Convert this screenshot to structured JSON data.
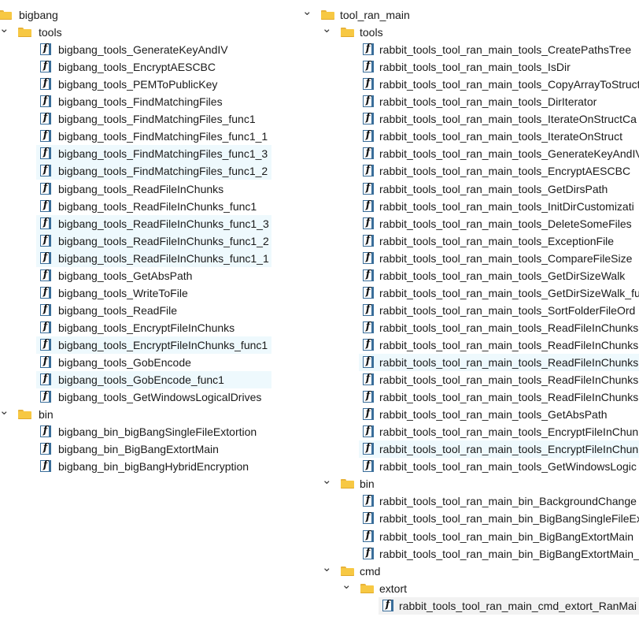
{
  "left": {
    "rows": [
      {
        "type": "folder",
        "depth": 0,
        "label": "bigbang",
        "chev": "collapse",
        "hl": false
      },
      {
        "type": "folder",
        "depth": 1,
        "label": "tools",
        "chev": "expand",
        "hl": false
      },
      {
        "type": "func",
        "depth": 2,
        "label": "bigbang_tools_GenerateKeyAndIV",
        "hl": false
      },
      {
        "type": "func",
        "depth": 2,
        "label": "bigbang_tools_EncryptAESCBC",
        "hl": false
      },
      {
        "type": "func",
        "depth": 2,
        "label": "bigbang_tools_PEMToPublicKey",
        "hl": false
      },
      {
        "type": "func",
        "depth": 2,
        "label": "bigbang_tools_FindMatchingFiles",
        "hl": false
      },
      {
        "type": "func",
        "depth": 2,
        "label": "bigbang_tools_FindMatchingFiles_func1",
        "hl": false
      },
      {
        "type": "func",
        "depth": 2,
        "label": "bigbang_tools_FindMatchingFiles_func1_1",
        "hl": false
      },
      {
        "type": "func",
        "depth": 2,
        "label": "bigbang_tools_FindMatchingFiles_func1_3",
        "hl": true
      },
      {
        "type": "func",
        "depth": 2,
        "label": "bigbang_tools_FindMatchingFiles_func1_2",
        "hl": true
      },
      {
        "type": "func",
        "depth": 2,
        "label": "bigbang_tools_ReadFileInChunks",
        "hl": false
      },
      {
        "type": "func",
        "depth": 2,
        "label": "bigbang_tools_ReadFileInChunks_func1",
        "hl": false
      },
      {
        "type": "func",
        "depth": 2,
        "label": "bigbang_tools_ReadFileInChunks_func1_3",
        "hl": true
      },
      {
        "type": "func",
        "depth": 2,
        "label": "bigbang_tools_ReadFileInChunks_func1_2",
        "hl": true
      },
      {
        "type": "func",
        "depth": 2,
        "label": "bigbang_tools_ReadFileInChunks_func1_1",
        "hl": true
      },
      {
        "type": "func",
        "depth": 2,
        "label": "bigbang_tools_GetAbsPath",
        "hl": false
      },
      {
        "type": "func",
        "depth": 2,
        "label": "bigbang_tools_WriteToFile",
        "hl": false
      },
      {
        "type": "func",
        "depth": 2,
        "label": "bigbang_tools_ReadFile",
        "hl": false
      },
      {
        "type": "func",
        "depth": 2,
        "label": "bigbang_tools_EncryptFileInChunks",
        "hl": false
      },
      {
        "type": "func",
        "depth": 2,
        "label": "bigbang_tools_EncryptFileInChunks_func1",
        "hl": true
      },
      {
        "type": "func",
        "depth": 2,
        "label": "bigbang_tools_GobEncode",
        "hl": false
      },
      {
        "type": "func",
        "depth": 2,
        "label": "bigbang_tools_GobEncode_func1",
        "hl": true
      },
      {
        "type": "func",
        "depth": 2,
        "label": "bigbang_tools_GetWindowsLogicalDrives",
        "hl": false
      },
      {
        "type": "folder",
        "depth": 1,
        "label": "bin",
        "chev": "expand",
        "hl": false
      },
      {
        "type": "func",
        "depth": 2,
        "label": "bigbang_bin_bigBangSingleFileExtortion",
        "hl": false
      },
      {
        "type": "func",
        "depth": 2,
        "label": "bigbang_bin_BigBangExtortMain",
        "hl": false
      },
      {
        "type": "func",
        "depth": 2,
        "label": "bigbang_bin_bigBangHybridEncryption",
        "hl": false
      }
    ]
  },
  "right": {
    "rows": [
      {
        "type": "folder",
        "depth": 0,
        "label": "tool_ran_main",
        "chev": "expand",
        "hl": false
      },
      {
        "type": "folder",
        "depth": 1,
        "label": "tools",
        "chev": "expand",
        "hl": false
      },
      {
        "type": "func",
        "depth": 2,
        "label": "rabbit_tools_tool_ran_main_tools_CreatePathsTree",
        "hl": false
      },
      {
        "type": "func",
        "depth": 2,
        "label": "rabbit_tools_tool_ran_main_tools_IsDir",
        "hl": false
      },
      {
        "type": "func",
        "depth": 2,
        "label": "rabbit_tools_tool_ran_main_tools_CopyArrayToStruct",
        "hl": false
      },
      {
        "type": "func",
        "depth": 2,
        "label": "rabbit_tools_tool_ran_main_tools_DirIterator",
        "hl": false
      },
      {
        "type": "func",
        "depth": 2,
        "label": "rabbit_tools_tool_ran_main_tools_IterateOnStructCa",
        "hl": false
      },
      {
        "type": "func",
        "depth": 2,
        "label": "rabbit_tools_tool_ran_main_tools_IterateOnStruct",
        "hl": false
      },
      {
        "type": "func",
        "depth": 2,
        "label": "rabbit_tools_tool_ran_main_tools_GenerateKeyAndIV",
        "hl": false
      },
      {
        "type": "func",
        "depth": 2,
        "label": "rabbit_tools_tool_ran_main_tools_EncryptAESCBC",
        "hl": false
      },
      {
        "type": "func",
        "depth": 2,
        "label": "rabbit_tools_tool_ran_main_tools_GetDirsPath",
        "hl": false
      },
      {
        "type": "func",
        "depth": 2,
        "label": "rabbit_tools_tool_ran_main_tools_InitDirCustomizati",
        "hl": false
      },
      {
        "type": "func",
        "depth": 2,
        "label": "rabbit_tools_tool_ran_main_tools_DeleteSomeFiles",
        "hl": false
      },
      {
        "type": "func",
        "depth": 2,
        "label": "rabbit_tools_tool_ran_main_tools_ExceptionFile",
        "hl": false
      },
      {
        "type": "func",
        "depth": 2,
        "label": "rabbit_tools_tool_ran_main_tools_CompareFileSize",
        "hl": false
      },
      {
        "type": "func",
        "depth": 2,
        "label": "rabbit_tools_tool_ran_main_tools_GetDirSizeWalk",
        "hl": false
      },
      {
        "type": "func",
        "depth": 2,
        "label": "rabbit_tools_tool_ran_main_tools_GetDirSizeWalk_fu",
        "hl": false
      },
      {
        "type": "func",
        "depth": 2,
        "label": "rabbit_tools_tool_ran_main_tools_SortFolderFileOrd",
        "hl": false
      },
      {
        "type": "func",
        "depth": 2,
        "label": "rabbit_tools_tool_ran_main_tools_ReadFileInChunks",
        "hl": false
      },
      {
        "type": "func",
        "depth": 2,
        "label": "rabbit_tools_tool_ran_main_tools_ReadFileInChunks",
        "hl": false
      },
      {
        "type": "func",
        "depth": 2,
        "label": "rabbit_tools_tool_ran_main_tools_ReadFileInChunks",
        "hl": true
      },
      {
        "type": "func",
        "depth": 2,
        "label": "rabbit_tools_tool_ran_main_tools_ReadFileInChunks",
        "hl": false
      },
      {
        "type": "func",
        "depth": 2,
        "label": "rabbit_tools_tool_ran_main_tools_ReadFileInChunks",
        "hl": false
      },
      {
        "type": "func",
        "depth": 2,
        "label": "rabbit_tools_tool_ran_main_tools_GetAbsPath",
        "hl": false
      },
      {
        "type": "func",
        "depth": 2,
        "label": "rabbit_tools_tool_ran_main_tools_EncryptFileInChun",
        "hl": false
      },
      {
        "type": "func",
        "depth": 2,
        "label": "rabbit_tools_tool_ran_main_tools_EncryptFileInChun",
        "hl": true
      },
      {
        "type": "func",
        "depth": 2,
        "label": "rabbit_tools_tool_ran_main_tools_GetWindowsLogic",
        "hl": false
      },
      {
        "type": "folder",
        "depth": 1,
        "label": "bin",
        "chev": "expand",
        "hl": false
      },
      {
        "type": "func",
        "depth": 2,
        "label": "rabbit_tools_tool_ran_main_bin_BackgroundChange",
        "hl": false
      },
      {
        "type": "func",
        "depth": 2,
        "label": "rabbit_tools_tool_ran_main_bin_BigBangSingleFileEx",
        "hl": false
      },
      {
        "type": "func",
        "depth": 2,
        "label": "rabbit_tools_tool_ran_main_bin_BigBangExtortMain",
        "hl": false
      },
      {
        "type": "func",
        "depth": 2,
        "label": "rabbit_tools_tool_ran_main_bin_BigBangExtortMain_",
        "hl": false
      },
      {
        "type": "folder",
        "depth": 1,
        "label": "cmd",
        "chev": "expand",
        "hl": false
      },
      {
        "type": "folder",
        "depth": 2,
        "label": "extort",
        "chev": "expand",
        "hl": false
      },
      {
        "type": "func",
        "depth": 3,
        "label": "rabbit_tools_tool_ran_main_cmd_extort_RanMai",
        "hl": false,
        "sel": true
      }
    ]
  },
  "colors": {
    "highlight": "#eef9fd",
    "selected": "#f2f2f2",
    "folder": "#f7c843",
    "icon_border": "#3a6e9a"
  },
  "icons": {
    "folder": "folder-icon",
    "function": "function-icon",
    "expand": "chevron-down-icon",
    "collapse": "chevron-right-icon"
  }
}
